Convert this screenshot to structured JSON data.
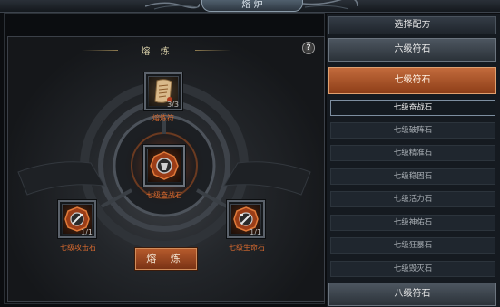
{
  "window": {
    "title": "熔 炉"
  },
  "forge": {
    "header": "熔 炼",
    "help_label": "?",
    "top_item": {
      "label": "熔炼符",
      "count": "3/3"
    },
    "center_item": {
      "label": "七级奋战石"
    },
    "left_item": {
      "label": "七级攻击石",
      "count": "1/1"
    },
    "right_item": {
      "label": "七级生命石",
      "count": "1/1"
    },
    "forge_button": "熔 炼"
  },
  "recipes": {
    "title": "选择配方",
    "categories": [
      "六级符石",
      "七级符石",
      "八级符石"
    ],
    "active_category": "七级符石",
    "items": [
      "七级奋战石",
      "七级破阵石",
      "七级精准石",
      "七级稳固石",
      "七级活力石",
      "七级神佑石",
      "七级狂暴石",
      "七级毁灭石"
    ],
    "selected_item": "七级奋战石"
  },
  "colors": {
    "accent": "#c36b3c",
    "label_orange": "#d86a2f",
    "panel_bg": "#151a20"
  },
  "icons": {
    "top_item": "scroll-icon",
    "center_item": "gem-icon",
    "left_item": "sword-gem-icon",
    "right_item": "heart-gem-icon",
    "help": "question-icon"
  }
}
